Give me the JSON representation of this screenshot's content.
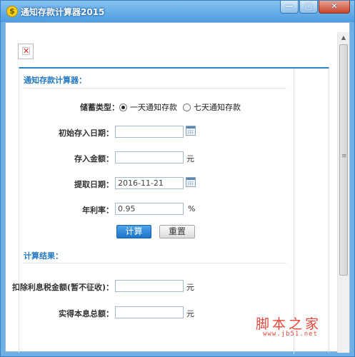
{
  "window": {
    "title": "通知存款计算器2015",
    "title_icon": "$",
    "controls": {
      "minimize": "—",
      "maximize": "□",
      "close": "✕"
    }
  },
  "image_placeholder": {
    "glyph": "✕"
  },
  "calculator": {
    "section_title": "通知存款计算器：",
    "savings_type": {
      "label": "储蓄类型：",
      "options": [
        "一天通知存款",
        "七天通知存款"
      ],
      "selected": "一天通知存款"
    },
    "deposit_date": {
      "label": "初始存入日期：",
      "value": ""
    },
    "deposit_amount": {
      "label": "存入金额：",
      "value": "",
      "unit": "元"
    },
    "withdraw_date": {
      "label": "提取日期：",
      "value": "2016-11-21"
    },
    "annual_rate": {
      "label": "年利率：",
      "value": "0.95",
      "unit": "%"
    },
    "buttons": {
      "calculate": "计算",
      "reset": "重置"
    }
  },
  "results": {
    "section_title": "计算结果：",
    "tax_deducted": {
      "label": "扣除利息税金额(暂不征收)：",
      "value": "",
      "unit": "元"
    },
    "total": {
      "label": "实得本息总额：",
      "value": "",
      "unit": "元"
    }
  },
  "watermark": {
    "text": "脚本之家",
    "url": "www.jb51.net"
  },
  "colors": {
    "accent": "#2679c0",
    "primary_button": "#1d74c8",
    "watermark": "#e8463a"
  }
}
